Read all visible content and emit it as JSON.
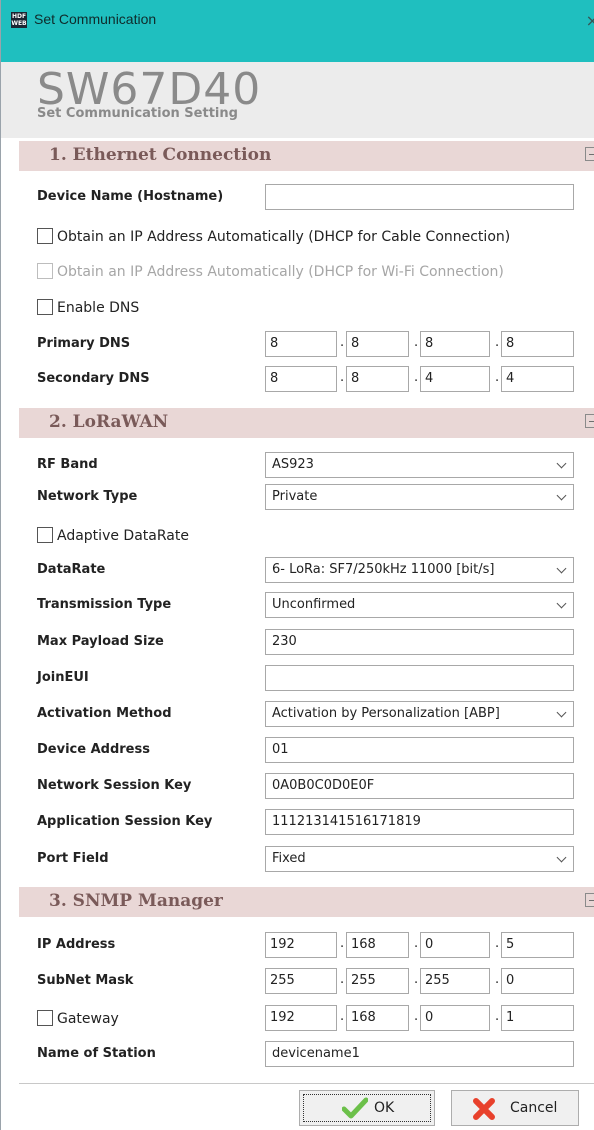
{
  "window": {
    "title": "Set Communication",
    "close_glyph": "×",
    "icon_text": "HDF WEB"
  },
  "header": {
    "product": "SW67D40",
    "subtitle": "Set Communication Setting"
  },
  "ethernet": {
    "title": "1. Ethernet Connection",
    "device_name_label": "Device Name (Hostname)",
    "device_name_value": "",
    "dhcp_cable_label": "Obtain an IP Address Automatically (DHCP for Cable Connection)",
    "dhcp_cable_checked": false,
    "dhcp_wifi_label": "Obtain an IP Address Automatically (DHCP for Wi-Fi Connection)",
    "dhcp_wifi_checked": false,
    "enable_dns_label": "Enable DNS",
    "enable_dns_checked": false,
    "primary_dns_label": "Primary DNS",
    "primary_dns": [
      "8",
      "8",
      "8",
      "8"
    ],
    "secondary_dns_label": "Secondary DNS",
    "secondary_dns": [
      "8",
      "8",
      "4",
      "4"
    ]
  },
  "lorawan": {
    "title": "2. LoRaWAN",
    "rf_band_label": "RF Band",
    "rf_band_value": "AS923",
    "network_type_label": "Network Type",
    "network_type_value": "Private",
    "adaptive_label": "Adaptive DataRate",
    "adaptive_checked": false,
    "datarate_label": "DataRate",
    "datarate_value": "6- LoRa: SF7/250kHz 11000 [bit/s]",
    "transmission_label": "Transmission Type",
    "transmission_value": "Unconfirmed",
    "payload_label": "Max Payload Size",
    "payload_value": "230",
    "joineui_label": "JoinEUI",
    "joineui_value": "",
    "activation_label": "Activation Method",
    "activation_value": "Activation by Personalization [ABP]",
    "device_address_label": "Device Address",
    "device_address_value": "01",
    "nwk_key_label": "Network Session Key",
    "nwk_key_value": "0A0B0C0D0E0F",
    "app_key_label": "Application Session Key",
    "app_key_value": "111213141516171819",
    "port_label": "Port Field",
    "port_value": "Fixed"
  },
  "snmp": {
    "title": "3. SNMP Manager",
    "ip_label": "IP Address",
    "ip": [
      "192",
      "168",
      "0",
      "5"
    ],
    "mask_label": "SubNet Mask",
    "mask": [
      "255",
      "255",
      "255",
      "0"
    ],
    "gateway_label": "Gateway",
    "gateway_checked": false,
    "gateway": [
      "192",
      "168",
      "0",
      "1"
    ],
    "station_label": "Name of Station",
    "station_value": "devicename1"
  },
  "buttons": {
    "ok_label": "OK",
    "cancel_label": "Cancel"
  },
  "colors": {
    "titlebar": "#1fbfbf",
    "section_header": "#e9d7d6",
    "section_title": "#7a5a59",
    "ok_check": "#6cc04a",
    "cancel_x": "#e8412c"
  }
}
